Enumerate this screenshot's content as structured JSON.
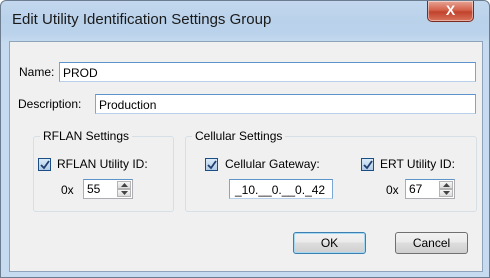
{
  "window": {
    "title": "Edit Utility Identification Settings Group",
    "close_glyph": "X"
  },
  "form": {
    "name_label": "Name:",
    "name_value": "PROD",
    "description_label": "Description:",
    "description_value": "Production"
  },
  "rflan": {
    "group_title": "RFLAN Settings",
    "checkbox_label": "RFLAN Utility ID:",
    "checked": true,
    "prefix": "0x",
    "value": "55"
  },
  "cellular": {
    "group_title": "Cellular Settings",
    "gateway_label": "Cellular Gateway:",
    "gateway_checked": true,
    "gateway_value": "_10.__0.__0._42",
    "ert_label": "ERT Utility ID:",
    "ert_checked": true,
    "ert_prefix": "0x",
    "ert_value": "67"
  },
  "buttons": {
    "ok_label": "OK",
    "cancel_label": "Cancel"
  },
  "icons": {
    "close": "close-icon",
    "check": "checkmark-icon",
    "spin_up": "spin-up-arrow-icon",
    "spin_down": "spin-down-arrow-icon"
  }
}
